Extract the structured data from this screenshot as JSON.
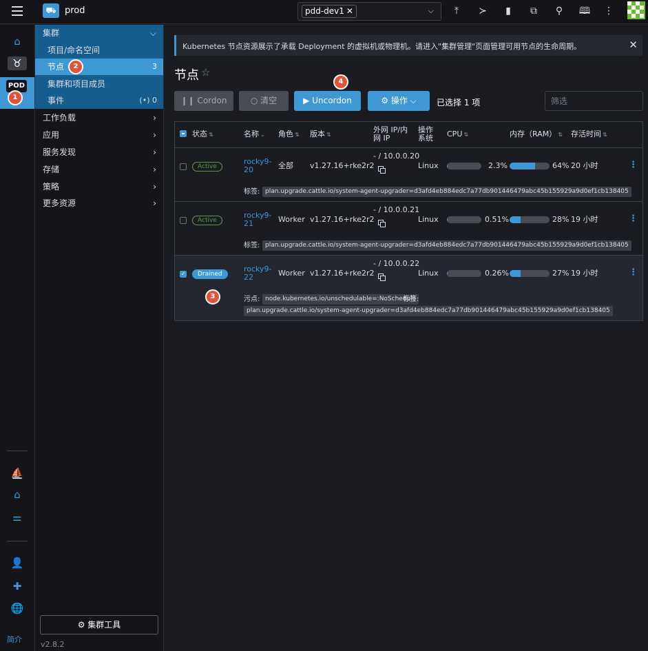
{
  "header": {
    "cluster_name": "prod",
    "namespace_filter": "pdd-dev1",
    "icons": [
      "upload-icon",
      "terminal-icon",
      "file-icon",
      "copy-config-icon",
      "search-icon",
      "book-icon",
      "more-vert-icon"
    ]
  },
  "rail": {
    "pod_label": "POD",
    "about": "简介"
  },
  "nav": {
    "cluster_group": "集群",
    "items": [
      {
        "label": "项目/命名空间"
      },
      {
        "label": "节点",
        "count": "3"
      },
      {
        "label": "集群和项目成员"
      },
      {
        "label": "事件",
        "count": "0"
      }
    ],
    "groups": [
      "工作负载",
      "应用",
      "服务发现",
      "存储",
      "策略",
      "更多资源"
    ],
    "tools_button": "集群工具",
    "version": "v2.8.2"
  },
  "banner": {
    "text": "Kubernetes 节点资源展示了承载 Deployment 的虚拟机或物理机。请进入\"集群管理\"页面管理可用节点的生命周期。"
  },
  "page": {
    "title": "节点"
  },
  "toolbar": {
    "cordon": "Cordon",
    "drain": "清空",
    "uncordon": "Uncordon",
    "actions": "操作",
    "selected": "已选择 1 项",
    "filter_placeholder": "筛选"
  },
  "table": {
    "headers": {
      "state": "状态",
      "name": "名称",
      "role": "角色",
      "version": "版本",
      "ip_line1": "外网 IP/内",
      "ip_line2": "网 IP",
      "os_line1": "操作",
      "os_line2": "系统",
      "cpu": "CPU",
      "ram": "内存（RAM）",
      "age": "存活时间"
    },
    "label_key": "标签:",
    "taint_key": "污点:",
    "rows": [
      {
        "state": "Active",
        "name_line1": "rocky9-",
        "name_line2": "20",
        "role": "全部",
        "version": "v1.27.16+rke2r2",
        "ip": "- / 10.0.0.20",
        "os": "Linux",
        "cpu_text": "2.3%",
        "cpu_pct": 2.3,
        "ram_text": "64%",
        "ram_pct": 64,
        "age": "20 小时",
        "label": "plan.upgrade.cattle.io/system-agent-upgrader=d3afd4eb884edc7a77db901446479abc45b155929a9d0ef1cb138405"
      },
      {
        "state": "Active",
        "name_line1": "rocky9-",
        "name_line2": "21",
        "role": "Worker",
        "version": "v1.27.16+rke2r2",
        "ip": "- / 10.0.0.21",
        "os": "Linux",
        "cpu_text": "0.51%",
        "cpu_pct": 0.51,
        "ram_text": "28%",
        "ram_pct": 28,
        "age": "19 小时",
        "label": "plan.upgrade.cattle.io/system-agent-upgrader=d3afd4eb884edc7a77db901446479abc45b155929a9d0ef1cb138405"
      },
      {
        "state": "Drained",
        "name_line1": "rocky9-",
        "name_line2": "22",
        "role": "Worker",
        "version": "v1.27.16+rke2r2",
        "ip": "- / 10.0.0.22",
        "os": "Linux",
        "cpu_text": "0.26%",
        "cpu_pct": 0.26,
        "ram_text": "27%",
        "ram_pct": 27,
        "age": "19 小时",
        "taint": "node.kubernetes.io/unschedulable=:NoSchedule",
        "label": "plan.upgrade.cattle.io/system-agent-upgrader=d3afd4eb884edc7a77db901446479abc45b155929a9d0ef1cb138405"
      }
    ]
  },
  "markers": [
    "1",
    "2",
    "3",
    "4"
  ],
  "colors": {
    "accent": "#3d98d3",
    "active_green": "#5a9b45",
    "marker_red": "#e0553a"
  }
}
